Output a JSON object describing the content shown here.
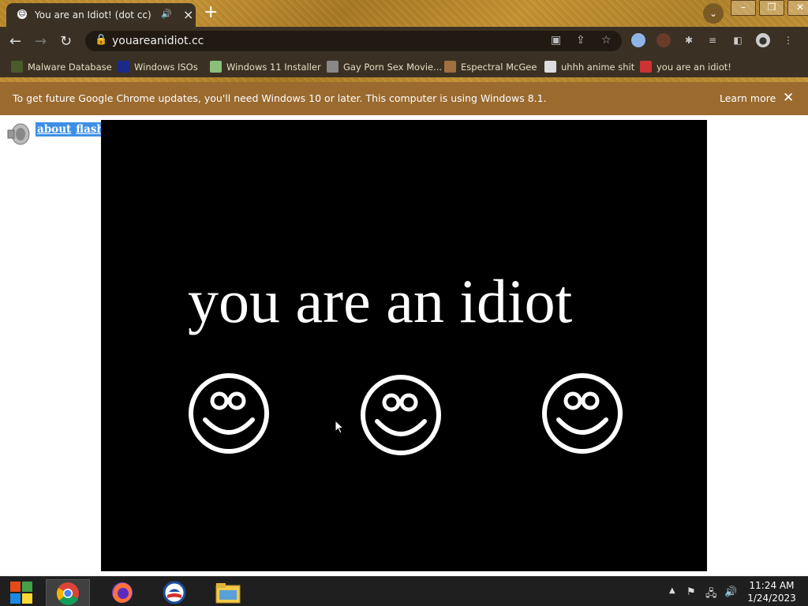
{
  "tab": {
    "title": "You are an Idiot! (dot cc)",
    "icon": "smiley-favicon"
  },
  "address": {
    "url": "youareanidiot.cc"
  },
  "bookmarks": [
    {
      "label": "Malware Database"
    },
    {
      "label": "Windows ISOs"
    },
    {
      "label": "Windows 11 Installer"
    },
    {
      "label": "Gay Porn Sex Movie..."
    },
    {
      "label": "Espectral McGee"
    },
    {
      "label": "uhhh anime shit"
    },
    {
      "label": "you are an idiot!"
    }
  ],
  "infobar": {
    "message": "To get future Google Chrome updates, you'll need Windows 10 or later. This computer is using Windows 8.1.",
    "action": "Learn more"
  },
  "page": {
    "link_about": "about",
    "link_flash": "flash",
    "headline": "you are an idiot",
    "smiley_count": 3
  },
  "taskbar": {
    "time": "11:24 AM",
    "date": "1/24/2023"
  },
  "colors": {
    "frame": "#3a3124",
    "infobar": "#9a6a2f",
    "stage": "#000000",
    "link_highlight": "#3b8fe6"
  }
}
